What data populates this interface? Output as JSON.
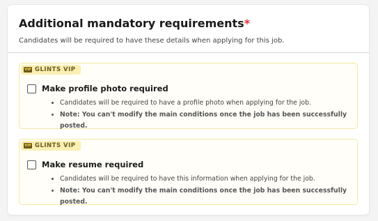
{
  "header": {
    "title": "Additional mandatory requirements",
    "required_mark": "*",
    "subtitle": "Candidates will be required to have these details when applying for this job."
  },
  "requirements": [
    {
      "badge": "GLINTS VIP",
      "badge_icon_text": "VIP",
      "label": "Make profile photo required",
      "checked": false,
      "bullets": [
        "Candidates will be required to have a profile photo when applying for the job.",
        "Note: You can't modify the main conditions once the job has been successfully posted."
      ]
    },
    {
      "badge": "GLINTS VIP",
      "badge_icon_text": "VIP",
      "label": "Make resume required",
      "checked": false,
      "bullets": [
        "Candidates will be required to have this information when applying for the job.",
        "Note: You can't modify the main conditions once the job has been successfully posted."
      ]
    }
  ],
  "colors": {
    "required_mark": "#e0303b",
    "vip_background": "#fbf0b4",
    "vip_text": "#6b5a1b",
    "box_border": "#f3e7a6"
  }
}
